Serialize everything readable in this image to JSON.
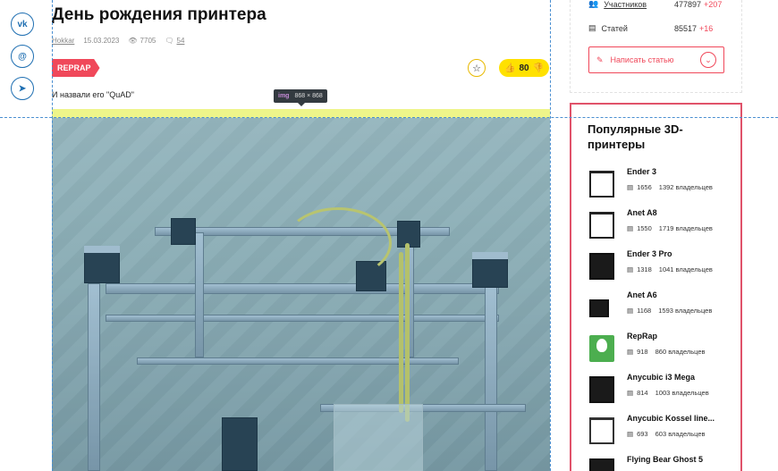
{
  "social": [
    {
      "icon": "vk-icon",
      "glyph": "vk"
    },
    {
      "icon": "mail-icon",
      "glyph": "@"
    },
    {
      "icon": "telegram-icon",
      "glyph": "➤"
    }
  ],
  "article": {
    "title": "День рождения принтера",
    "author": "Hokkar",
    "date": "15.03.2023",
    "views": "7705",
    "comments": "54",
    "tag": "REPRAP",
    "rating": "80",
    "lead": "И назвали его \"QuAD\"",
    "tooltip": {
      "tag": "img",
      "size": "868 × 868"
    }
  },
  "stats": {
    "members_label": "Участников",
    "members_value": "477897",
    "members_delta": "+207",
    "articles_label": "Статей",
    "articles_value": "85517",
    "articles_delta": "+16",
    "write_button": "Написать статью"
  },
  "popular": {
    "title": "Популярные 3D-принтеры",
    "items": [
      {
        "name": "Ender 3",
        "articles": "1656",
        "owners": "1392 владельцев"
      },
      {
        "name": "Anet A8",
        "articles": "1550",
        "owners": "1719 владельцев"
      },
      {
        "name": "Ender 3 Pro",
        "articles": "1318",
        "owners": "1041 владельцев"
      },
      {
        "name": "Anet A6",
        "articles": "1168",
        "owners": "1593 владельцев"
      },
      {
        "name": "RepRap",
        "articles": "918",
        "owners": "860 владельцев"
      },
      {
        "name": "Anycubic i3 Mega",
        "articles": "814",
        "owners": "1003 владельцев"
      },
      {
        "name": "Anycubic Kossel line...",
        "articles": "693",
        "owners": "603 владельцев"
      },
      {
        "name": "Flying Bear Ghost 5",
        "articles": "",
        "owners": ""
      }
    ]
  },
  "colors": {
    "accent": "#f0485a",
    "rating_bg": "#ffe100",
    "social": "#1f6fb2"
  }
}
